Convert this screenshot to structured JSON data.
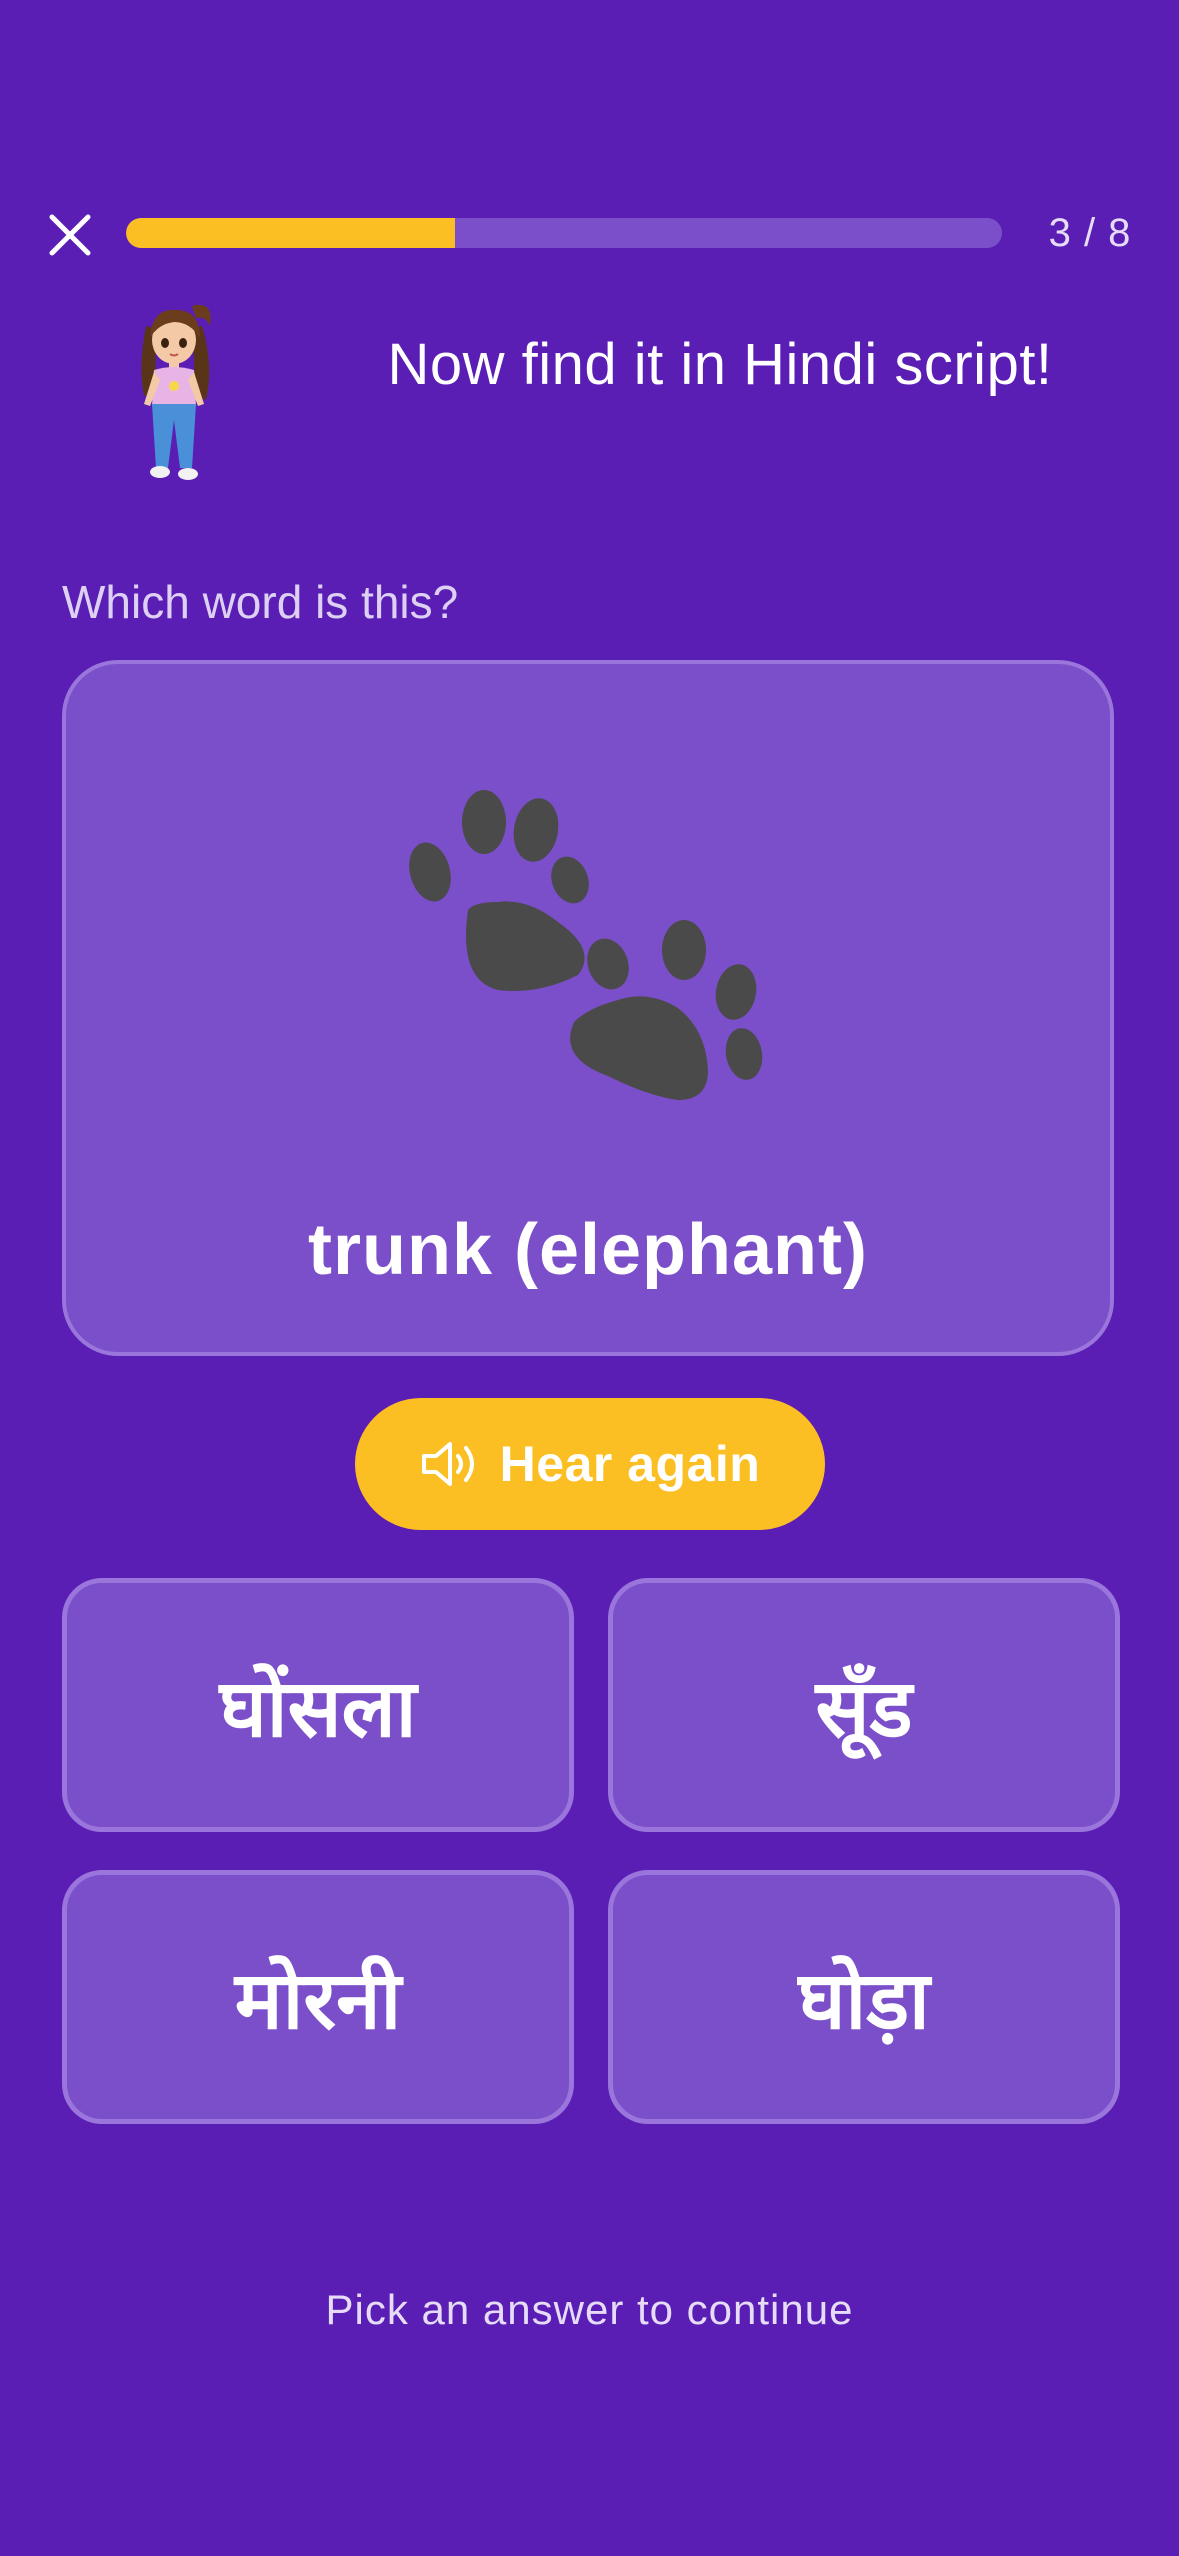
{
  "header": {
    "close_icon": "close-icon",
    "progress": {
      "current": 3,
      "total": 8,
      "fraction": 0.375,
      "label": "3 / 8"
    },
    "accent_color": "#fbbf24"
  },
  "mascot": {
    "icon": "girl-mascot"
  },
  "heading": "Now find it in Hindi script!",
  "question": "Which word is this?",
  "prompt": {
    "icon": "paw-prints-icon",
    "word": "trunk (elephant)"
  },
  "hear_button": {
    "icon": "speaker-icon",
    "label": "Hear again"
  },
  "options": [
    {
      "label": "घोंसला"
    },
    {
      "label": "सूँड"
    },
    {
      "label": "मोरनी"
    },
    {
      "label": "घोड़ा"
    }
  ],
  "footer_hint": "Pick an answer to continue",
  "colors": {
    "background": "#5a1eb5",
    "card": "#7b4fc9",
    "card_border": "#9a75db",
    "button": "#fbbf24"
  }
}
